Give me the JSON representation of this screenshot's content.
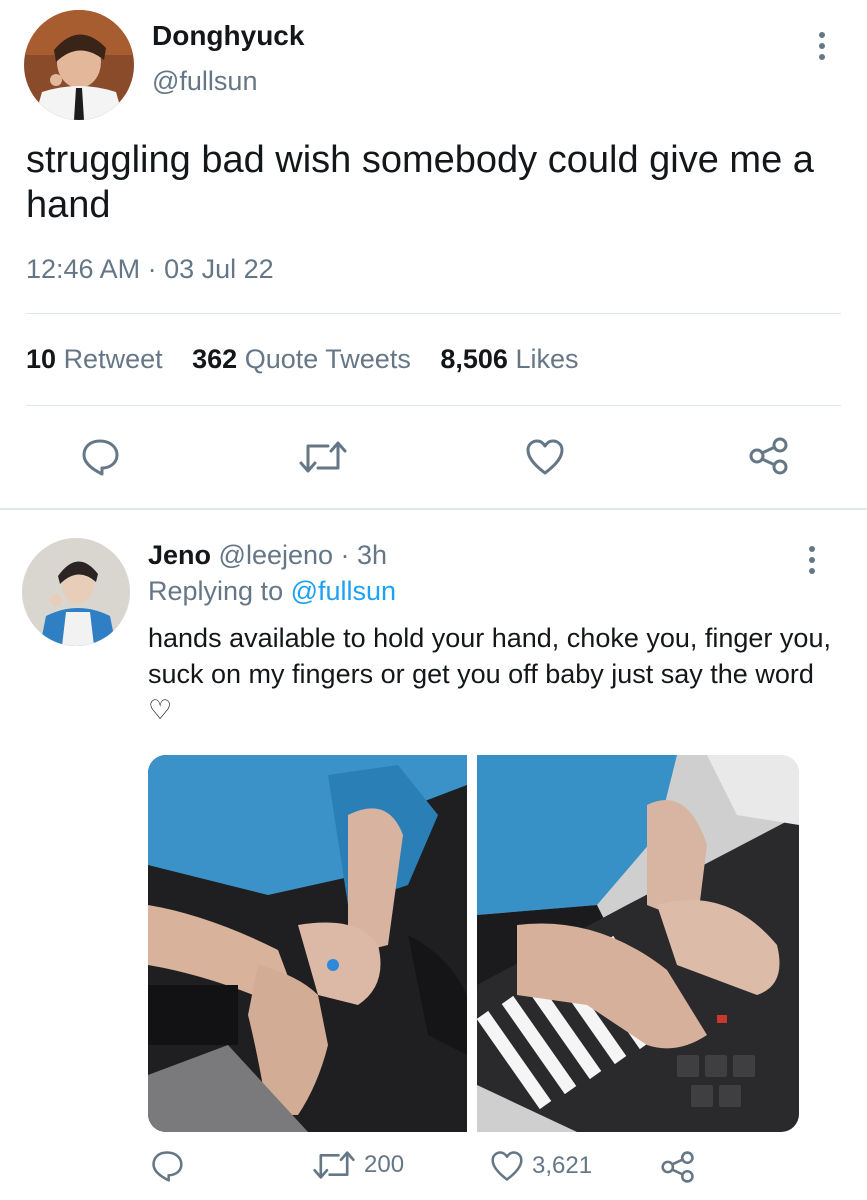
{
  "tweet": {
    "display_name": "Donghyuck",
    "handle": "@fullsun",
    "text": "struggling bad wish somebody could give me a hand",
    "timestamp": "12:46 AM · 03 Jul 22",
    "stats": {
      "retweets_count": "10",
      "retweets_label": "Retweet",
      "quotes_count": "362",
      "quotes_label": "Quote Tweets",
      "likes_count": "8,506",
      "likes_label": "Likes"
    },
    "actions": [
      "reply-icon",
      "retweet-icon",
      "heart-icon",
      "share-icon"
    ]
  },
  "reply": {
    "display_name": "Jeno",
    "handle_time": "@leejeno · 3h",
    "replying_prefix": "Replying to",
    "replying_handle": "@fullsun",
    "text": "hands available to hold your hand, choke you, finger you, suck on my fingers or get you off baby just say the word ♡",
    "retweet_count": "200",
    "like_count": "3,621"
  },
  "colors": {
    "text": "#14171a",
    "secondary": "#657786",
    "link": "#1da1f2",
    "divider": "#e1e8ed"
  }
}
